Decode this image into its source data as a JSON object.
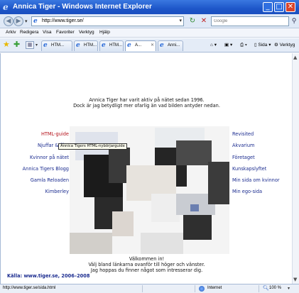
{
  "window": {
    "title": "Annica Tiger - Windows Internet Explorer",
    "minimize": "_",
    "maximize": "□",
    "close": "✕"
  },
  "address_bar": {
    "url": "http://www.tiger.se/",
    "search_placeholder": "Google"
  },
  "menu": [
    "Arkiv",
    "Redigera",
    "Visa",
    "Favoriter",
    "Verktyg",
    "Hjälp"
  ],
  "tabs": [
    {
      "label": "HTM...",
      "active": false
    },
    {
      "label": "HTM...",
      "active": false
    },
    {
      "label": "HTM...",
      "active": false
    },
    {
      "label": "A...",
      "active": true
    },
    {
      "label": "Anni...",
      "active": false
    }
  ],
  "toolbar_right": {
    "page": "Sida",
    "tools": "Verktyg"
  },
  "content": {
    "intro_line1": "Annica Tiger har varit aktiv på nätet sedan 1996.",
    "intro_line2": "Dock är jag betydligt mer ofarlig än vad bilden antyder nedan.",
    "left_links": [
      "HTML-guide",
      "Njuffar & fäst",
      "Kvinnor på nätet",
      "Annica Tigers Blogg",
      "Gamla Reloaden",
      "Kimberley"
    ],
    "right_links": [
      "Revisited",
      "Akvarium",
      "Företaget",
      "Kunskapslyftet",
      "Min sida om kvinnor",
      "Min ego-sida"
    ],
    "tooltip": "Annica Tigers HTML-nybörjarguide",
    "outro_line1": "Välkommen in!",
    "outro_line2": "Välj bland länkarna ovanför till höger och vänster.",
    "outro_line3": "Jag hoppas du finner något som intresserar dig.",
    "source": "Källa: www.tiger.se, 2006–2008"
  },
  "statusbar": {
    "url": "http://www.tiger.se/sida.html",
    "zone": "Internet",
    "zoom": "100 %"
  },
  "colors": {
    "titlebar": "#1e57c9",
    "link": "#1a2b8f",
    "link_hover": "#b5121b"
  }
}
